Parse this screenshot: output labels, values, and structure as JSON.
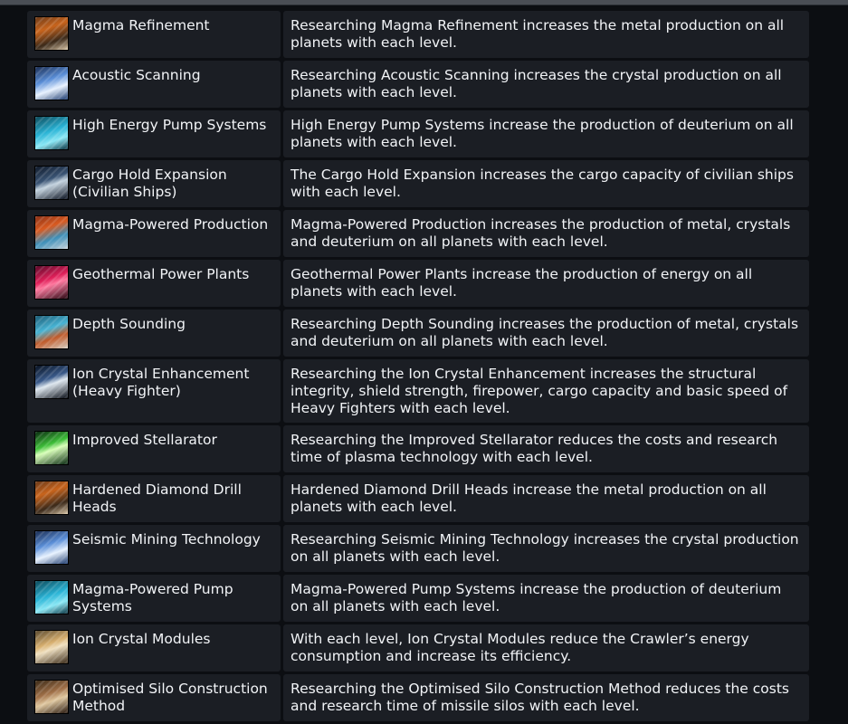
{
  "technologies": [
    {
      "name": "Magma Refinement",
      "icon": "metal-icon",
      "description": "Researching Magma Refinement increases the metal production on all planets with each level."
    },
    {
      "name": "Acoustic Scanning",
      "icon": "crystal-icon",
      "description": "Researching Acoustic Scanning increases the crystal production on all planets with each level."
    },
    {
      "name": "High Energy Pump Systems",
      "icon": "deuterium-icon",
      "description": "High Energy Pump Systems increase the production of deuterium on all planets with each level."
    },
    {
      "name": "Cargo Hold Expansion (Civilian Ships)",
      "icon": "ship-icon",
      "description": "The Cargo Hold Expansion increases the cargo capacity of civilian ships with each level."
    },
    {
      "name": "Magma-Powered Production",
      "icon": "magma-production-icon",
      "description": "Magma-Powered Production increases the production of metal, crystals and deuterium on all planets with each level."
    },
    {
      "name": "Geothermal Power Plants",
      "icon": "geothermal-icon",
      "description": "Geothermal Power Plants increase the production of energy on all planets with each level."
    },
    {
      "name": "Depth Sounding",
      "icon": "depth-sounding-icon",
      "description": "Researching Depth Sounding increases the production of metal, crystals and deuterium on all planets with each level."
    },
    {
      "name": "Ion Crystal Enhancement (Heavy Fighter)",
      "icon": "heavy-fighter-icon",
      "description": "Researching the Ion Crystal Enhancement increases the structural integrity, shield strength, firepower, cargo capacity and basic speed of Heavy Fighters with each level."
    },
    {
      "name": "Improved Stellarator",
      "icon": "stellarator-icon",
      "description": "Researching the Improved Stellarator reduces the costs and research time of plasma technology with each level."
    },
    {
      "name": "Hardened Diamond Drill Heads",
      "icon": "metal-icon",
      "description": "Hardened Diamond Drill Heads increase the metal production on all planets with each level."
    },
    {
      "name": "Seismic Mining Technology",
      "icon": "crystal-icon",
      "description": "Researching Seismic Mining Technology increases the crystal production on all planets with each level."
    },
    {
      "name": "Magma-Powered Pump Systems",
      "icon": "deuterium-icon",
      "description": "Magma-Powered Pump Systems increase the production of deuterium on all planets with each level."
    },
    {
      "name": "Ion Crystal Modules",
      "icon": "crawler-icon",
      "description": "With each level, Ion Crystal Modules reduce the Crawler’s energy consumption and increase its efficiency."
    },
    {
      "name": "Optimised Silo Construction Method",
      "icon": "silo-icon",
      "description": "Researching the Optimised Silo Construction Method reduces the costs and research time of missile silos with each level."
    }
  ]
}
